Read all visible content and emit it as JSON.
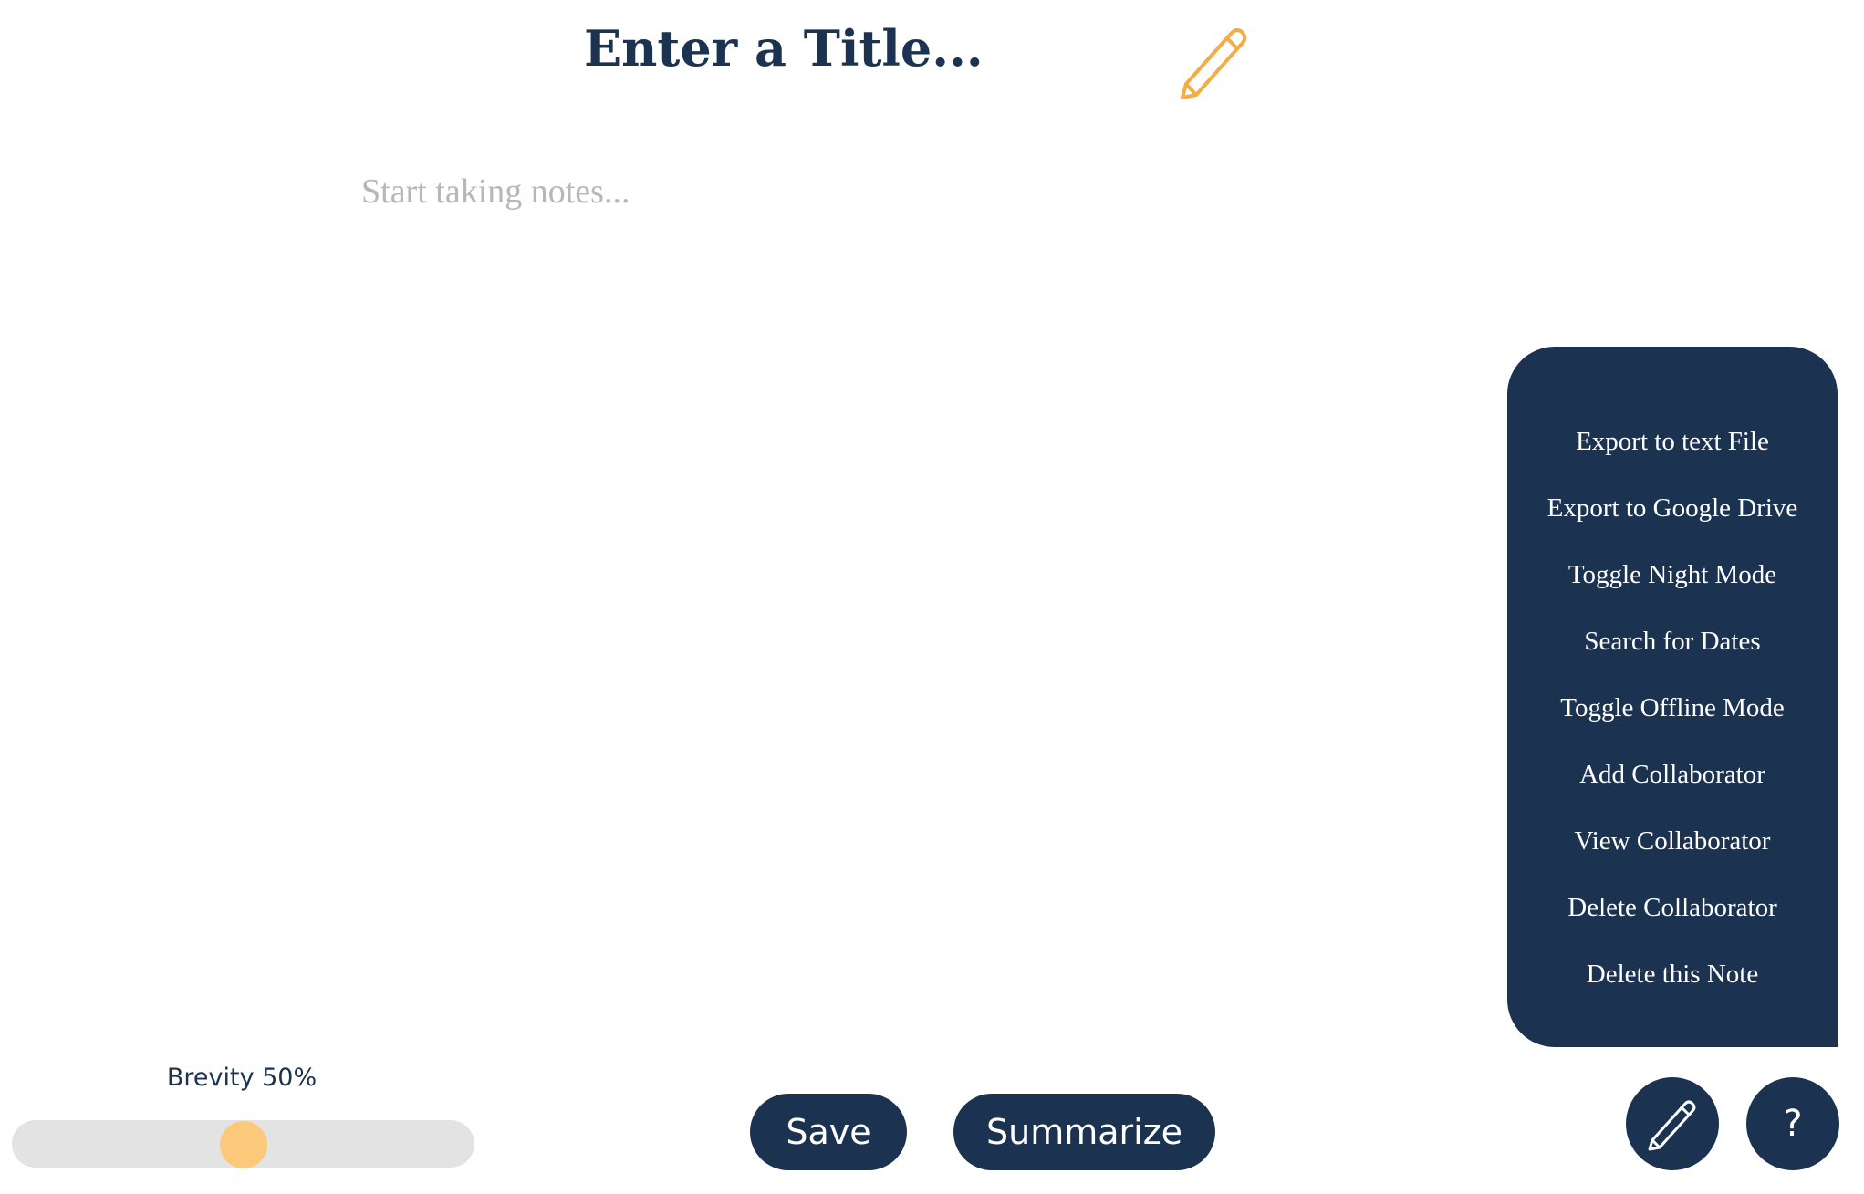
{
  "note": {
    "title_placeholder": "Enter a Title...",
    "body_placeholder": "Start taking notes...",
    "title_edit_icon": "pencil-icon"
  },
  "menu": {
    "items": [
      {
        "label": "Export to text File"
      },
      {
        "label": "Export to Google Drive"
      },
      {
        "label": "Toggle Night Mode"
      },
      {
        "label": "Search for Dates"
      },
      {
        "label": "Toggle Offline Mode"
      },
      {
        "label": "Add Collaborator"
      },
      {
        "label": "View Collaborator"
      },
      {
        "label": "Delete Collaborator"
      },
      {
        "label": "Delete this Note"
      }
    ]
  },
  "brevity": {
    "label": "Brevity 50%",
    "value_percent": 50
  },
  "actions": {
    "save_label": "Save",
    "summarize_label": "Summarize"
  },
  "floating": {
    "edit_icon": "pencil-icon",
    "help_label": "?"
  },
  "colors": {
    "primary": "#1b3350",
    "accent": "#f4ac45",
    "slider_thumb": "#fcc97b",
    "slider_track": "#e3e3e3",
    "placeholder": "#b7b7b7"
  }
}
